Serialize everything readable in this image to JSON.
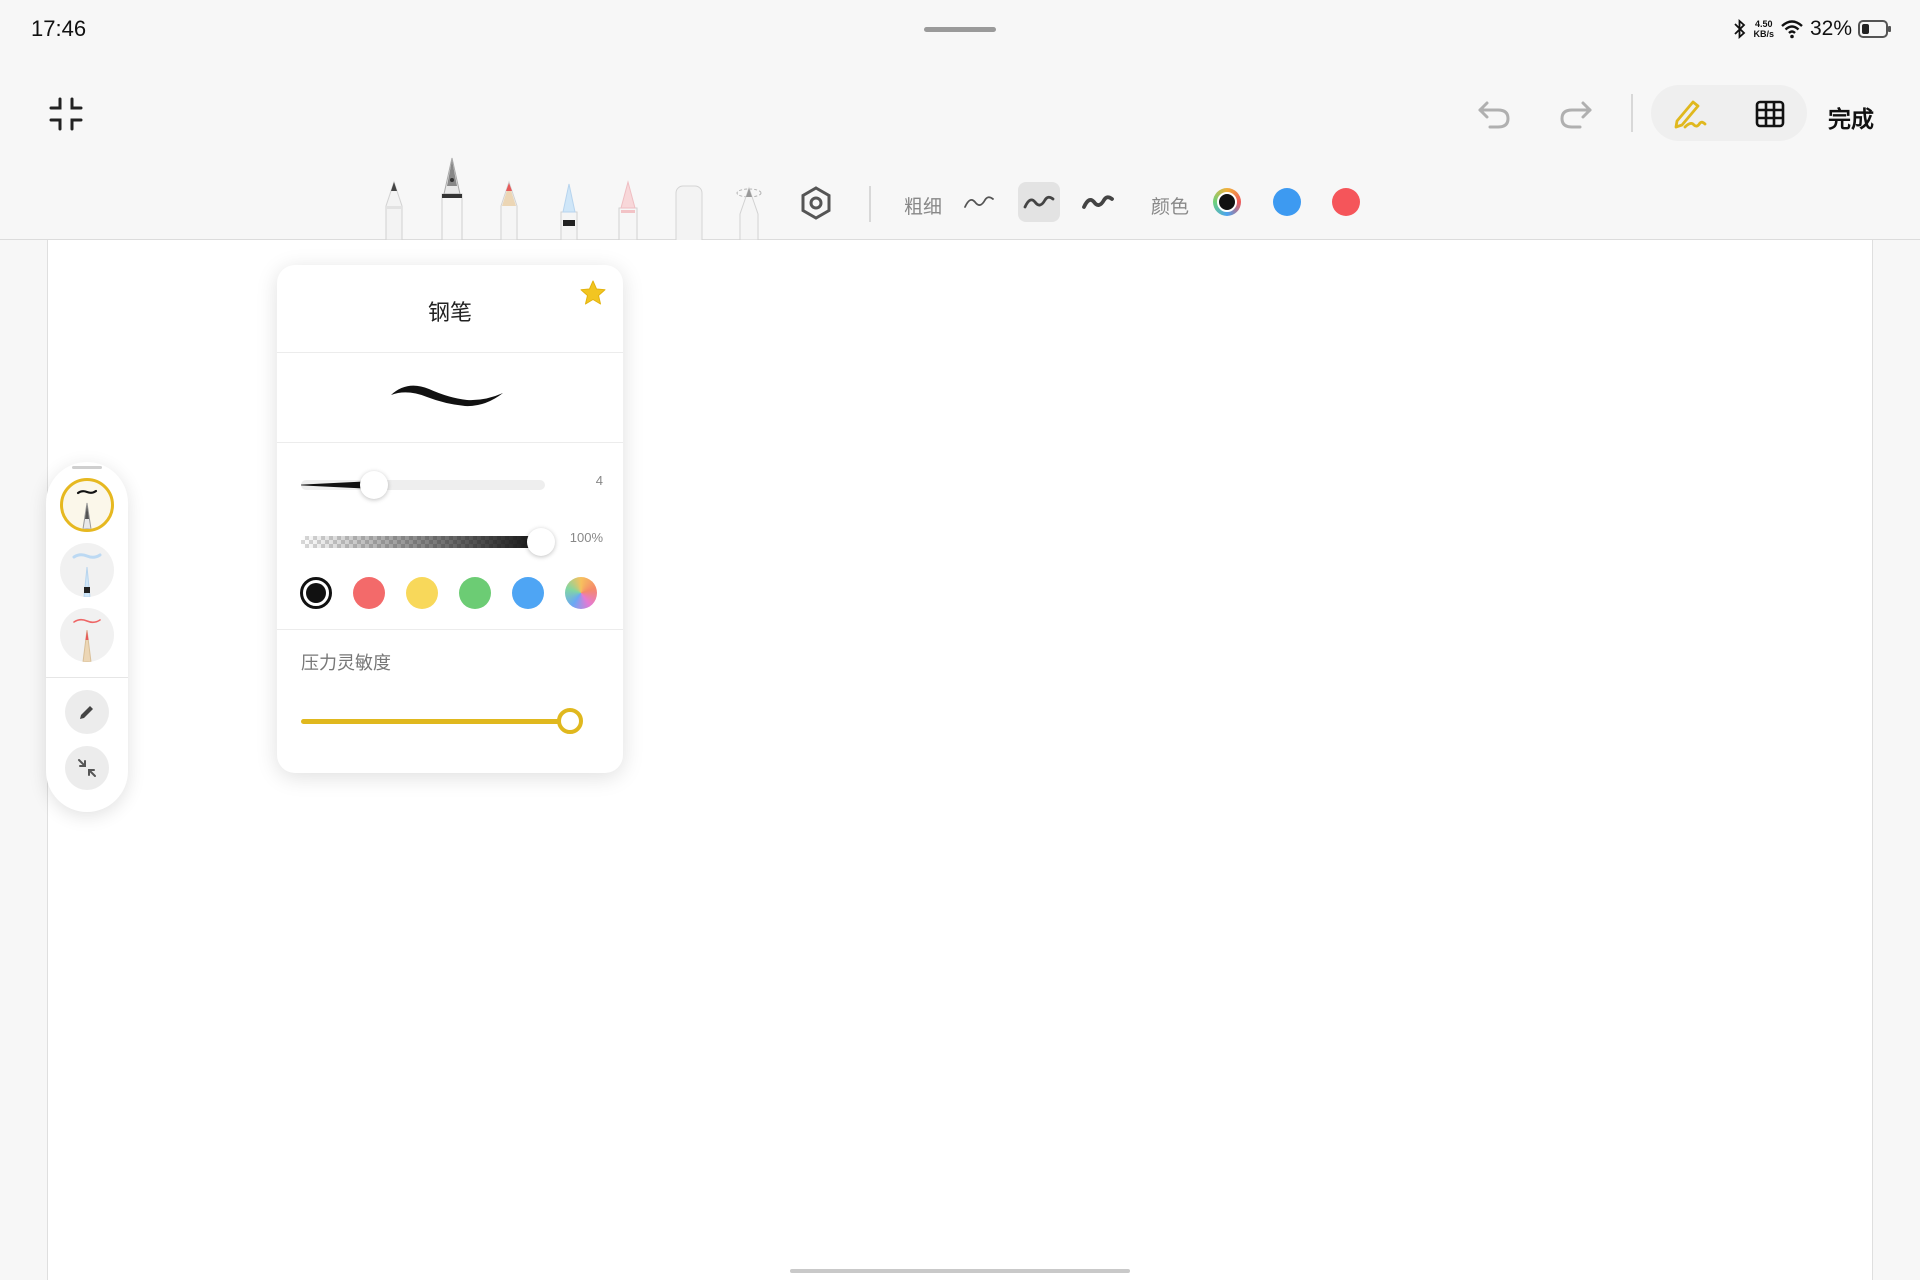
{
  "status_bar": {
    "time": "17:46",
    "network_speed_value": "4.50",
    "network_speed_unit": "KB/s",
    "battery_percent": "32%",
    "battery_level": 0.32
  },
  "header": {
    "done_label": "完成",
    "accent_color": "#e0b81e"
  },
  "toolbar": {
    "thickness_label": "粗细",
    "color_label": "颜色",
    "tools": [
      "ballpoint-pen",
      "fountain-pen",
      "pencil",
      "marker",
      "highlighter",
      "eraser",
      "lasso"
    ],
    "quick_colors": [
      "#111111",
      "#3d9af1",
      "#f5555a"
    ]
  },
  "side_panel": {
    "pens": [
      "fountain-pen",
      "marker-blue",
      "pencil-red"
    ]
  },
  "popup": {
    "title": "钢笔",
    "size_value": "4",
    "size_fraction": 0.3,
    "opacity_value": "100%",
    "opacity_fraction": 1.0,
    "colors": [
      "#111111",
      "#f36a6a",
      "#f8d85a",
      "#6ccc74",
      "#4ea5f4",
      "spectrum"
    ],
    "pressure_label": "压力灵敏度",
    "pressure_fraction": 1.0
  }
}
